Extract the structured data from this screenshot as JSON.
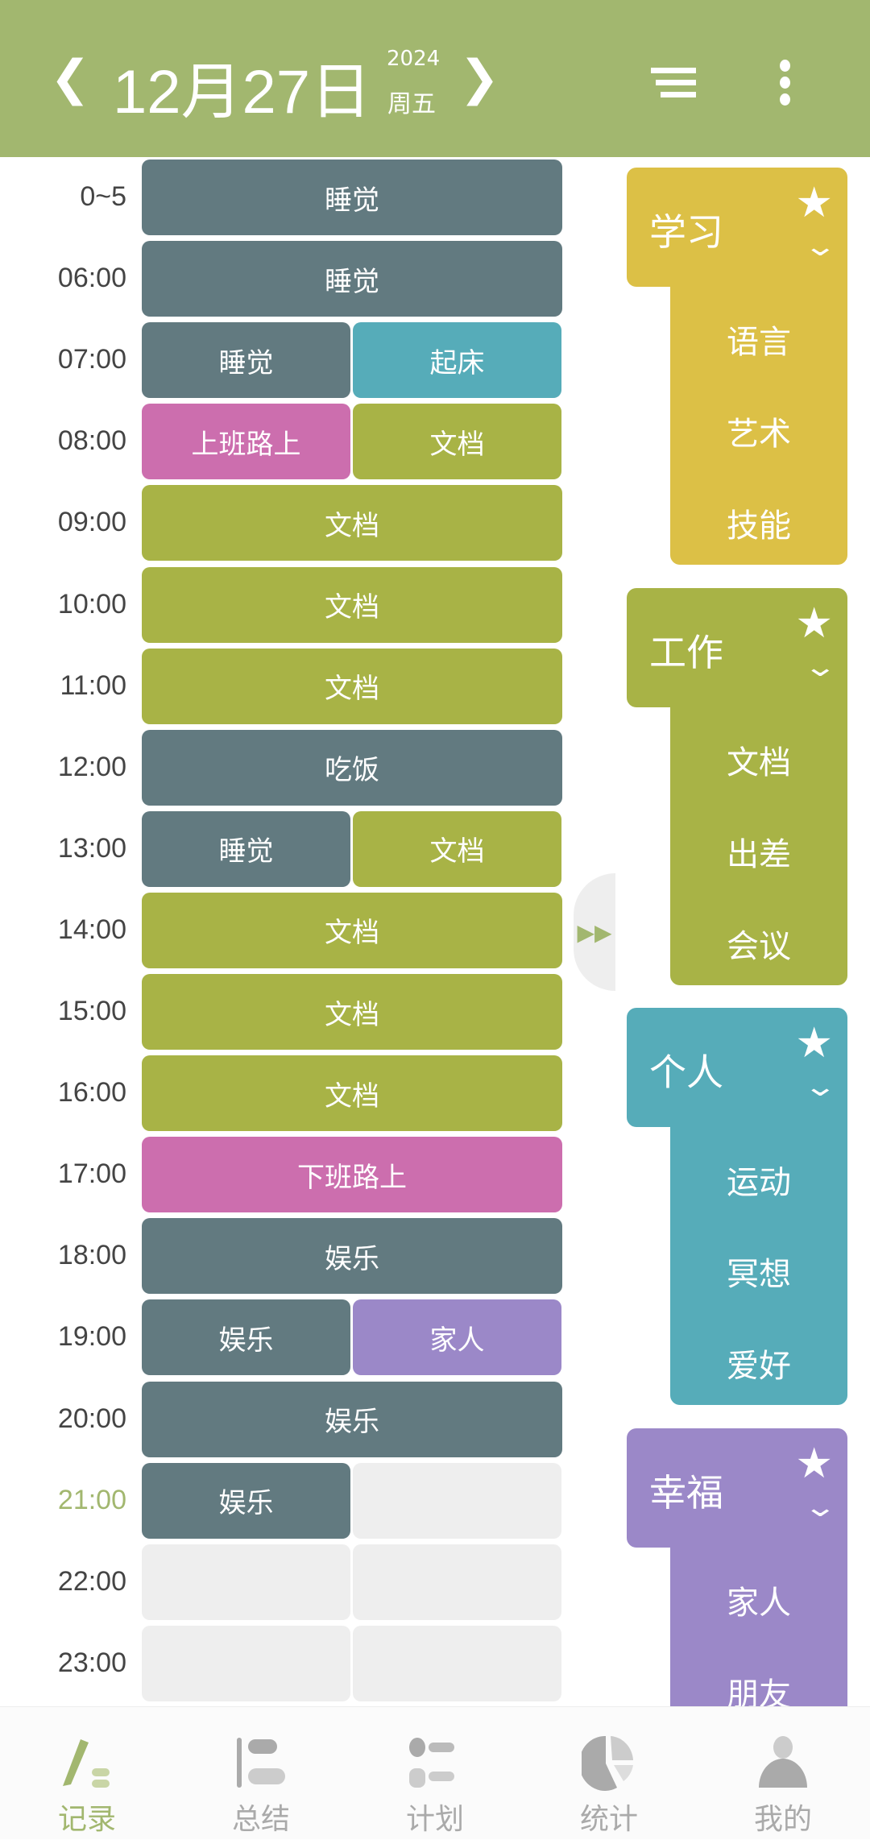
{
  "header": {
    "date": "12月27日",
    "year": "2024",
    "weekday": "周五",
    "prev_icon": "chevron-left-icon",
    "next_icon": "chevron-right-icon",
    "menu_icon": "sort-lines-icon",
    "more_icon": "more-vertical-icon"
  },
  "colors": {
    "header": "#a2b76f",
    "sleep": "#627a80",
    "wake": "#56acb9",
    "commute": "#cc6eae",
    "work": "#a8b346",
    "family": "#9b88c8",
    "study": "#dcc046",
    "empty": "#eeeeee",
    "current_time": "#a2b76f"
  },
  "current_time_label": "21:00",
  "rows": [
    {
      "time": "0~5",
      "blocks": [
        {
          "label": "睡觉",
          "color": "sleep",
          "span": 2
        }
      ]
    },
    {
      "time": "06:00",
      "blocks": [
        {
          "label": "睡觉",
          "color": "sleep",
          "span": 2
        }
      ]
    },
    {
      "time": "07:00",
      "blocks": [
        {
          "label": "睡觉",
          "color": "sleep",
          "span": 1
        },
        {
          "label": "起床",
          "color": "wake",
          "span": 1
        }
      ]
    },
    {
      "time": "08:00",
      "blocks": [
        {
          "label": "上班路上",
          "color": "commute",
          "span": 1
        },
        {
          "label": "文档",
          "color": "work",
          "span": 1
        }
      ]
    },
    {
      "time": "09:00",
      "blocks": [
        {
          "label": "文档",
          "color": "work",
          "span": 2
        }
      ]
    },
    {
      "time": "10:00",
      "blocks": [
        {
          "label": "文档",
          "color": "work",
          "span": 2
        }
      ]
    },
    {
      "time": "11:00",
      "blocks": [
        {
          "label": "文档",
          "color": "work",
          "span": 2
        }
      ]
    },
    {
      "time": "12:00",
      "blocks": [
        {
          "label": "吃饭",
          "color": "sleep",
          "span": 2
        }
      ]
    },
    {
      "time": "13:00",
      "blocks": [
        {
          "label": "睡觉",
          "color": "sleep",
          "span": 1
        },
        {
          "label": "文档",
          "color": "work",
          "span": 1
        }
      ]
    },
    {
      "time": "14:00",
      "blocks": [
        {
          "label": "文档",
          "color": "work",
          "span": 2
        }
      ]
    },
    {
      "time": "15:00",
      "blocks": [
        {
          "label": "文档",
          "color": "work",
          "span": 2
        }
      ]
    },
    {
      "time": "16:00",
      "blocks": [
        {
          "label": "文档",
          "color": "work",
          "span": 2
        }
      ]
    },
    {
      "time": "17:00",
      "blocks": [
        {
          "label": "下班路上",
          "color": "commute",
          "span": 2
        }
      ]
    },
    {
      "time": "18:00",
      "blocks": [
        {
          "label": "娱乐",
          "color": "sleep",
          "span": 2
        }
      ]
    },
    {
      "time": "19:00",
      "blocks": [
        {
          "label": "娱乐",
          "color": "sleep",
          "span": 1
        },
        {
          "label": "家人",
          "color": "family",
          "span": 1
        }
      ]
    },
    {
      "time": "20:00",
      "blocks": [
        {
          "label": "娱乐",
          "color": "sleep",
          "span": 2
        }
      ]
    },
    {
      "time": "21:00",
      "blocks": [
        {
          "label": "娱乐",
          "color": "sleep",
          "span": 1
        },
        {
          "label": "",
          "color": "empty",
          "span": 1
        }
      ]
    },
    {
      "time": "22:00",
      "blocks": [
        {
          "label": "",
          "color": "empty",
          "span": 1
        },
        {
          "label": "",
          "color": "empty",
          "span": 1
        }
      ]
    },
    {
      "time": "23:00",
      "blocks": [
        {
          "label": "",
          "color": "empty",
          "span": 1
        },
        {
          "label": "",
          "color": "empty",
          "span": 1
        }
      ]
    }
  ],
  "panel_toggle_icon": "fast-forward-icon",
  "groups": [
    {
      "title": "学习",
      "color": "study",
      "items": [
        "语言",
        "艺术",
        "技能"
      ]
    },
    {
      "title": "工作",
      "color": "work",
      "items": [
        "文档",
        "出差",
        "会议"
      ]
    },
    {
      "title": "个人",
      "color": "wake",
      "items": [
        "运动",
        "冥想",
        "爱好"
      ]
    },
    {
      "title": "幸福",
      "color": "family",
      "items": [
        "家人",
        "朋友"
      ]
    }
  ],
  "nav": [
    {
      "label": "记录",
      "icon": "pen-record-icon",
      "active": true
    },
    {
      "label": "总结",
      "icon": "summary-list-icon",
      "active": false
    },
    {
      "label": "计划",
      "icon": "plan-list-icon",
      "active": false
    },
    {
      "label": "统计",
      "icon": "pie-chart-icon",
      "active": false
    },
    {
      "label": "我的",
      "icon": "user-icon",
      "active": false
    }
  ]
}
